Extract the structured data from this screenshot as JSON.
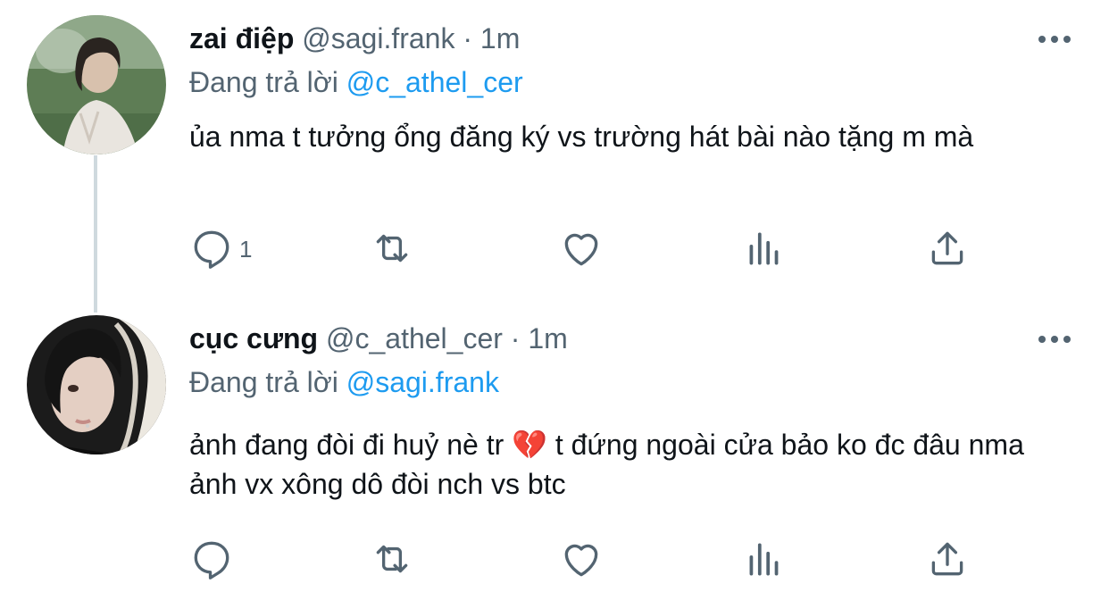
{
  "tweets": [
    {
      "name": "zai điệp",
      "handle": "@sagi.frank",
      "separator": "·",
      "time": "1m",
      "reply_prefix": "Đang trả lời",
      "reply_to": "@c_athel_cer",
      "text": "ủa nma t tưởng ổng đăng ký vs trường hát bài nào tặng m mà",
      "reply_count": "1",
      "avatar_colors": {
        "bg": "#6c8a5e",
        "skin": "#d9c3b0",
        "hair": "#2a2420",
        "shirt": "#e8e4de"
      }
    },
    {
      "name": "cục cưng",
      "handle": "@c_athel_cer",
      "separator": "·",
      "time": "1m",
      "reply_prefix": "Đang trả lời",
      "reply_to": "@sagi.frank",
      "text": "ảnh đang đòi đi huỷ nè tr 💔 t đứng ngoài cửa bảo ko đc đâu nma ảnh vx xông dô đòi nch vs btc",
      "reply_count": "",
      "avatar_colors": {
        "bg": "#1a1a1a",
        "skin": "#e6d2c6",
        "hair": "#141414",
        "fur": "#ece8e0"
      }
    }
  ],
  "icons": {
    "reply": "reply-icon",
    "retweet": "retweet-icon",
    "like": "heart-icon",
    "views": "views-icon",
    "share": "share-icon",
    "more": "more-icon"
  },
  "colors": {
    "text": "#0f1419",
    "secondary": "#536471",
    "link": "#1d9bf0",
    "thread_line": "#cfd9de"
  }
}
